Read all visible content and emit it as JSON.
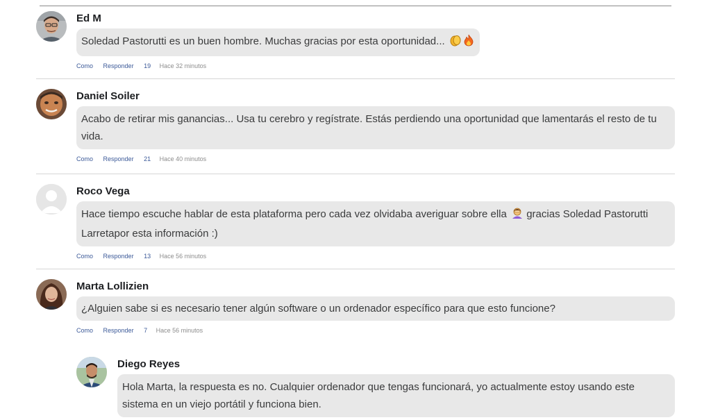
{
  "comments": [
    {
      "author": "Ed M",
      "text": "Soledad Pastorutti es un buen hombre. Muchas gracias por esta oportunidad...",
      "like_label": "Como",
      "reply_label": "Responder",
      "likes": "19",
      "time": "Hace 32 minutos"
    },
    {
      "author": "Daniel Soiler",
      "text": "Acabo de retirar mis ganancias... Usa tu cerebro y regístrate. Estás perdiendo una oportunidad que lamentarás el resto de tu vida.",
      "like_label": "Como",
      "reply_label": "Responder",
      "likes": "21",
      "time": "Hace 40 minutos"
    },
    {
      "author": "Roco Vega",
      "text_before": "Hace tiempo escuche hablar de esta plataforma pero cada vez olvidaba averiguar sobre ella",
      "text_after": "gracias Soledad Pastorutti Larretapor esta información :)",
      "like_label": "Como",
      "reply_label": "Responder",
      "likes": "13",
      "time": "Hace 56 minutos"
    },
    {
      "author": "Marta Lollizien",
      "text": "¿Alguien sabe si es necesario tener algún software o un ordenador específico para que esto funcione?",
      "like_label": "Como",
      "reply_label": "Responder",
      "likes": "7",
      "time": "Hace 56 minutos"
    }
  ],
  "reply": {
    "author": "Diego Reyes",
    "text": "Hola Marta, la respuesta es no. Cualquier ordenador que tengas funcionará, yo actualmente estoy usando este sistema en un viejo portátil y funciona bien."
  },
  "icons": {
    "emoji_1": "clapping-hands-icon",
    "emoji_2": "fire-icon",
    "emoji_3": "person-facepalming-icon"
  },
  "colors": {
    "link": "#3b5998",
    "bubble": "#e8e8e8",
    "time": "#8d8d8d"
  }
}
